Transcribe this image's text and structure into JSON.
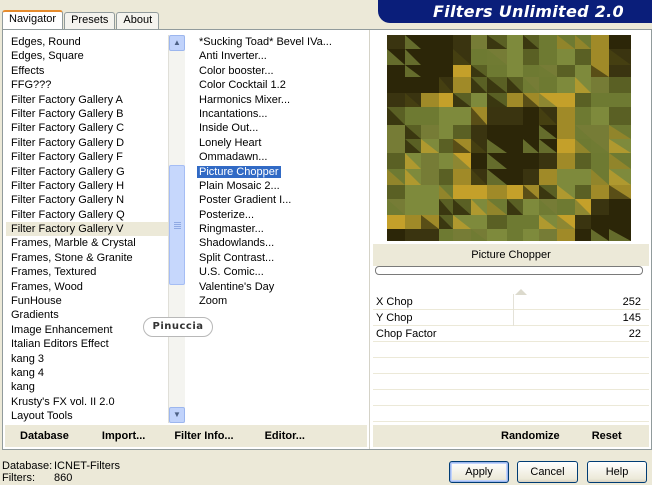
{
  "tabs": [
    {
      "label": "Navigator",
      "active": true
    },
    {
      "label": "Presets",
      "active": false
    },
    {
      "label": "About",
      "active": false
    }
  ],
  "brand_title": "Filters Unlimited 2.0",
  "categories": [
    "Edges, Round",
    "Edges, Square",
    "Effects",
    "FFG???",
    "Filter Factory Gallery A",
    "Filter Factory Gallery B",
    "Filter Factory Gallery C",
    "Filter Factory Gallery D",
    "Filter Factory Gallery F",
    "Filter Factory Gallery G",
    "Filter Factory Gallery H",
    "Filter Factory Gallery N",
    "Filter Factory Gallery Q",
    "Filter Factory Gallery V",
    "Frames, Marble & Crystal",
    "Frames, Stone & Granite",
    "Frames, Textured",
    "Frames, Wood",
    "FunHouse",
    "Gradients",
    "Image Enhancement",
    "Italian Editors Effect",
    "kang 3",
    "kang 4",
    "kang",
    "Krusty's FX vol. II 2.0",
    "Layout Tools"
  ],
  "selected_category_index": 13,
  "filters": [
    "*Sucking Toad*  Bevel IVa...",
    "Anti Inverter...",
    "Color booster...",
    "Color Cocktail 1.2",
    "Harmonics Mixer...",
    "Incantations...",
    "Inside Out...",
    "Lonely Heart",
    "Ommadawn...",
    "Picture Chopper",
    "Plain Mosaic 2...",
    "Poster Gradient I...",
    "Posterize...",
    "Ringmaster...",
    "Shadowlands...",
    "Split Contrast...",
    "U.S. Comic...",
    "Valentine's Day",
    "Zoom"
  ],
  "selected_filter_index": 9,
  "preview": {
    "filter_name": "Picture Chopper",
    "progress": 0
  },
  "params": [
    {
      "label": "X Chop",
      "value": "252"
    },
    {
      "label": "Y Chop",
      "value": "145"
    },
    {
      "label": "Chop Factor",
      "value": "22"
    }
  ],
  "toolbar": {
    "database": "Database",
    "import": "Import...",
    "filter_info": "Filter Info...",
    "editor": "Editor...",
    "randomize": "Randomize",
    "reset": "Reset"
  },
  "watermark": "Pinuccia",
  "footer": {
    "database_label": "Database:",
    "database_value": "ICNET-Filters",
    "filters_label": "Filters:",
    "filters_value": "860"
  },
  "buttons": {
    "apply": "Apply",
    "cancel": "Cancel",
    "help": "Help"
  },
  "colors": {
    "brand": "#0a1e7a",
    "selection": "#316ac5",
    "preview_olive": "#6e7a32",
    "preview_dark": "#2c2608"
  }
}
